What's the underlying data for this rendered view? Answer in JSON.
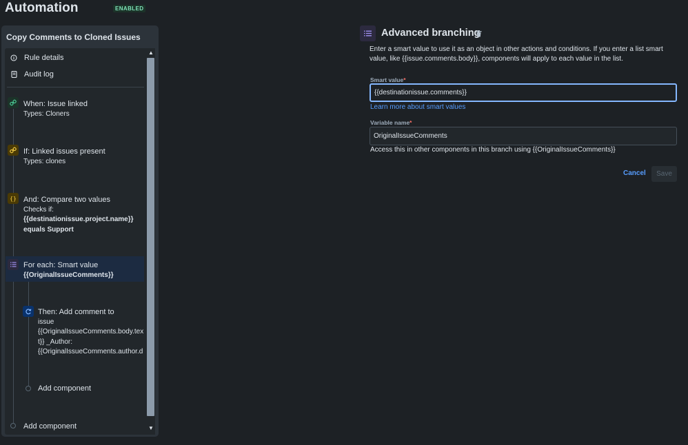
{
  "header": {
    "title": "Automation",
    "badge": "ENABLED"
  },
  "rule": {
    "name": "Copy Comments to Cloned Issues"
  },
  "nav": {
    "rule_details": "Rule details",
    "audit_log": "Audit log"
  },
  "components": {
    "trigger": {
      "title": "When: Issue linked",
      "sub": "Types: Cloners"
    },
    "condition1": {
      "title": "If: Linked issues present",
      "sub": "Types: clones"
    },
    "condition2": {
      "title": "And: Compare two values",
      "sub": "Checks if:",
      "bold1": "{{destinationissue.project.name}}",
      "bold2": "equals Support"
    },
    "branch": {
      "title": "For each: Smart value",
      "bold": "{{OriginalIssueComments}}"
    },
    "action": {
      "line1": "Then: Add comment to",
      "line2": "issue",
      "line3": "{{OriginalIssueComments.body.tex",
      "line4": "t}} _Author:",
      "line5": "{{OriginalIssueComments.author.d"
    },
    "add_inner": "Add component",
    "add_outer": "Add component"
  },
  "editor": {
    "title": "Advanced branching",
    "description": "Enter a smart value to use it as an object in other actions and conditions. If you enter a list smart value, like {{issue.comments.body}}, components will apply to each value in the list.",
    "smart_value_label": "Smart value",
    "smart_value": "{{destinationissue.comments}}",
    "learn_more": "Learn more about smart values",
    "variable_label": "Variable name",
    "variable_value": "OriginalIssueComments",
    "variable_help": "Access this in other components in this branch using {{OriginalIssueComments}}",
    "required_mark": "*",
    "cancel": "Cancel",
    "save": "Save"
  },
  "colors": {
    "accent": "#579dff",
    "success": "#7ee2b8",
    "trigger": "#1c3329",
    "condition": "#4a3a05",
    "branch": "#2c2a3f",
    "action": "#09326c"
  }
}
